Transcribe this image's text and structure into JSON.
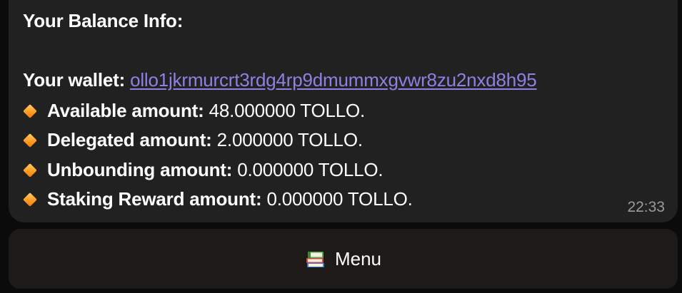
{
  "message": {
    "title": "Your Balance Info:",
    "wallet_label": "Your wallet:",
    "wallet_address": "ollo1jkrmurcrt3rdg4rp9dmummxgvwr8zu2nxd8h95",
    "items": [
      {
        "label": "Available amount:",
        "value": " 48.000000 TOLLO.",
        "icon": "orange-diamond-icon"
      },
      {
        "label": "Delegated amount:",
        "value": " 2.000000 TOLLO.",
        "icon": "orange-diamond-icon"
      },
      {
        "label": "Unbounding amount:",
        "value": " 0.000000 TOLLO.",
        "icon": "orange-diamond-icon"
      },
      {
        "label": "Staking Reward amount:",
        "value": " 0.000000 TOLLO.",
        "icon": "orange-diamond-icon"
      }
    ],
    "time": "22:33"
  },
  "keyboard": {
    "menu_label": "Menu",
    "menu_icon": "books-icon"
  },
  "colors": {
    "bubble": "#212121",
    "link": "#8f80e3",
    "button": "#1d1a17",
    "accent": "#ff9d1f"
  }
}
